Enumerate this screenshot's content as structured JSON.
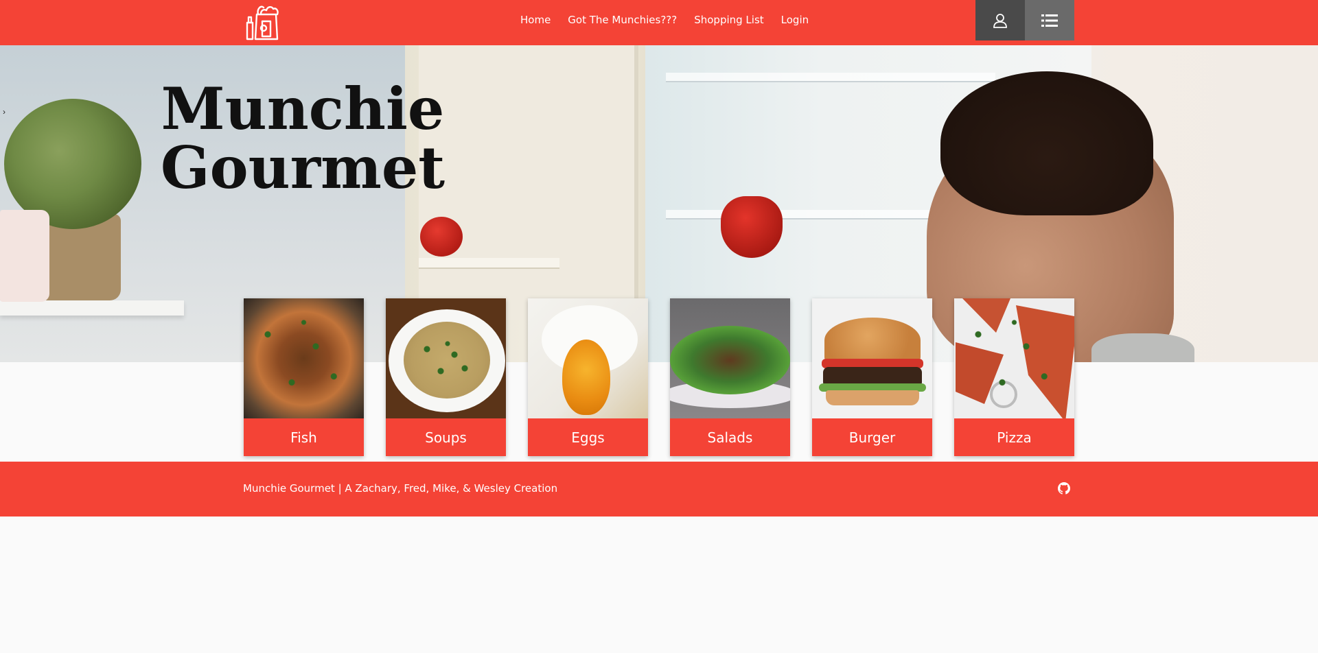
{
  "nav": {
    "links": [
      "Home",
      "Got The Munchies???",
      "Shopping List",
      "Login"
    ]
  },
  "hero": {
    "title_line1": "Munchie",
    "title_line2": "Gourmet"
  },
  "categories": [
    "Fish",
    "Soups",
    "Eggs",
    "Salads",
    "Burger",
    "Pizza"
  ],
  "footer": {
    "text": "Munchie Gourmet | A Zachary, Fred, Mike, & Wesley Creation"
  },
  "icons": {
    "logo": "grocery-bag-icon",
    "user": "user-icon",
    "menu": "list-icon",
    "github": "github-icon"
  },
  "colors": {
    "primary": "#f44336",
    "user_button": "#4a4a4a",
    "menu_button": "#6a6a6a"
  }
}
